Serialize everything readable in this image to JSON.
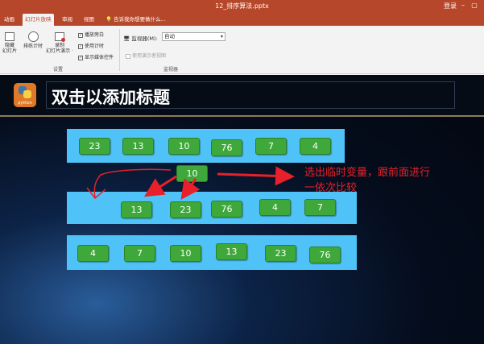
{
  "window": {
    "title": "12_排序算法.pptx",
    "login": "登录"
  },
  "tabs": [
    "动画",
    "幻灯片放映",
    "审阅",
    "视图"
  ],
  "active_tab": "幻灯片放映",
  "tell_me": "告诉我你想要做什么...",
  "ribbon": {
    "hide_slide": "隐藏\n幻灯片",
    "rehearse": "排练计时",
    "record": "录制\n幻灯片演示 ·",
    "play_narration": "播放旁白",
    "use_timings": "使用计时",
    "show_media_controls": "显示媒体控件",
    "setup_group": "设置",
    "monitor_label": "监视器(M):",
    "monitor_value": "自动",
    "presenter_view": "使用演示者视图",
    "monitor_group": "监视器"
  },
  "slide": {
    "logo_text": "python",
    "title": "双击以添加标题",
    "row1": [
      "23",
      "13",
      "10",
      "76",
      "7",
      "4"
    ],
    "temp": "10",
    "row2": [
      "13",
      "23",
      "76",
      "4",
      "7"
    ],
    "row3": [
      "4",
      "7",
      "10",
      "13",
      "23",
      "76"
    ],
    "annotation_line1": "选出临时变量，跟前面进行",
    "annotation_line2": "一依次比较"
  },
  "colors": {
    "accent": "#b7472a",
    "bar": "#4fc3f7",
    "box": "#3fa83a",
    "ink": "#e8202a"
  }
}
